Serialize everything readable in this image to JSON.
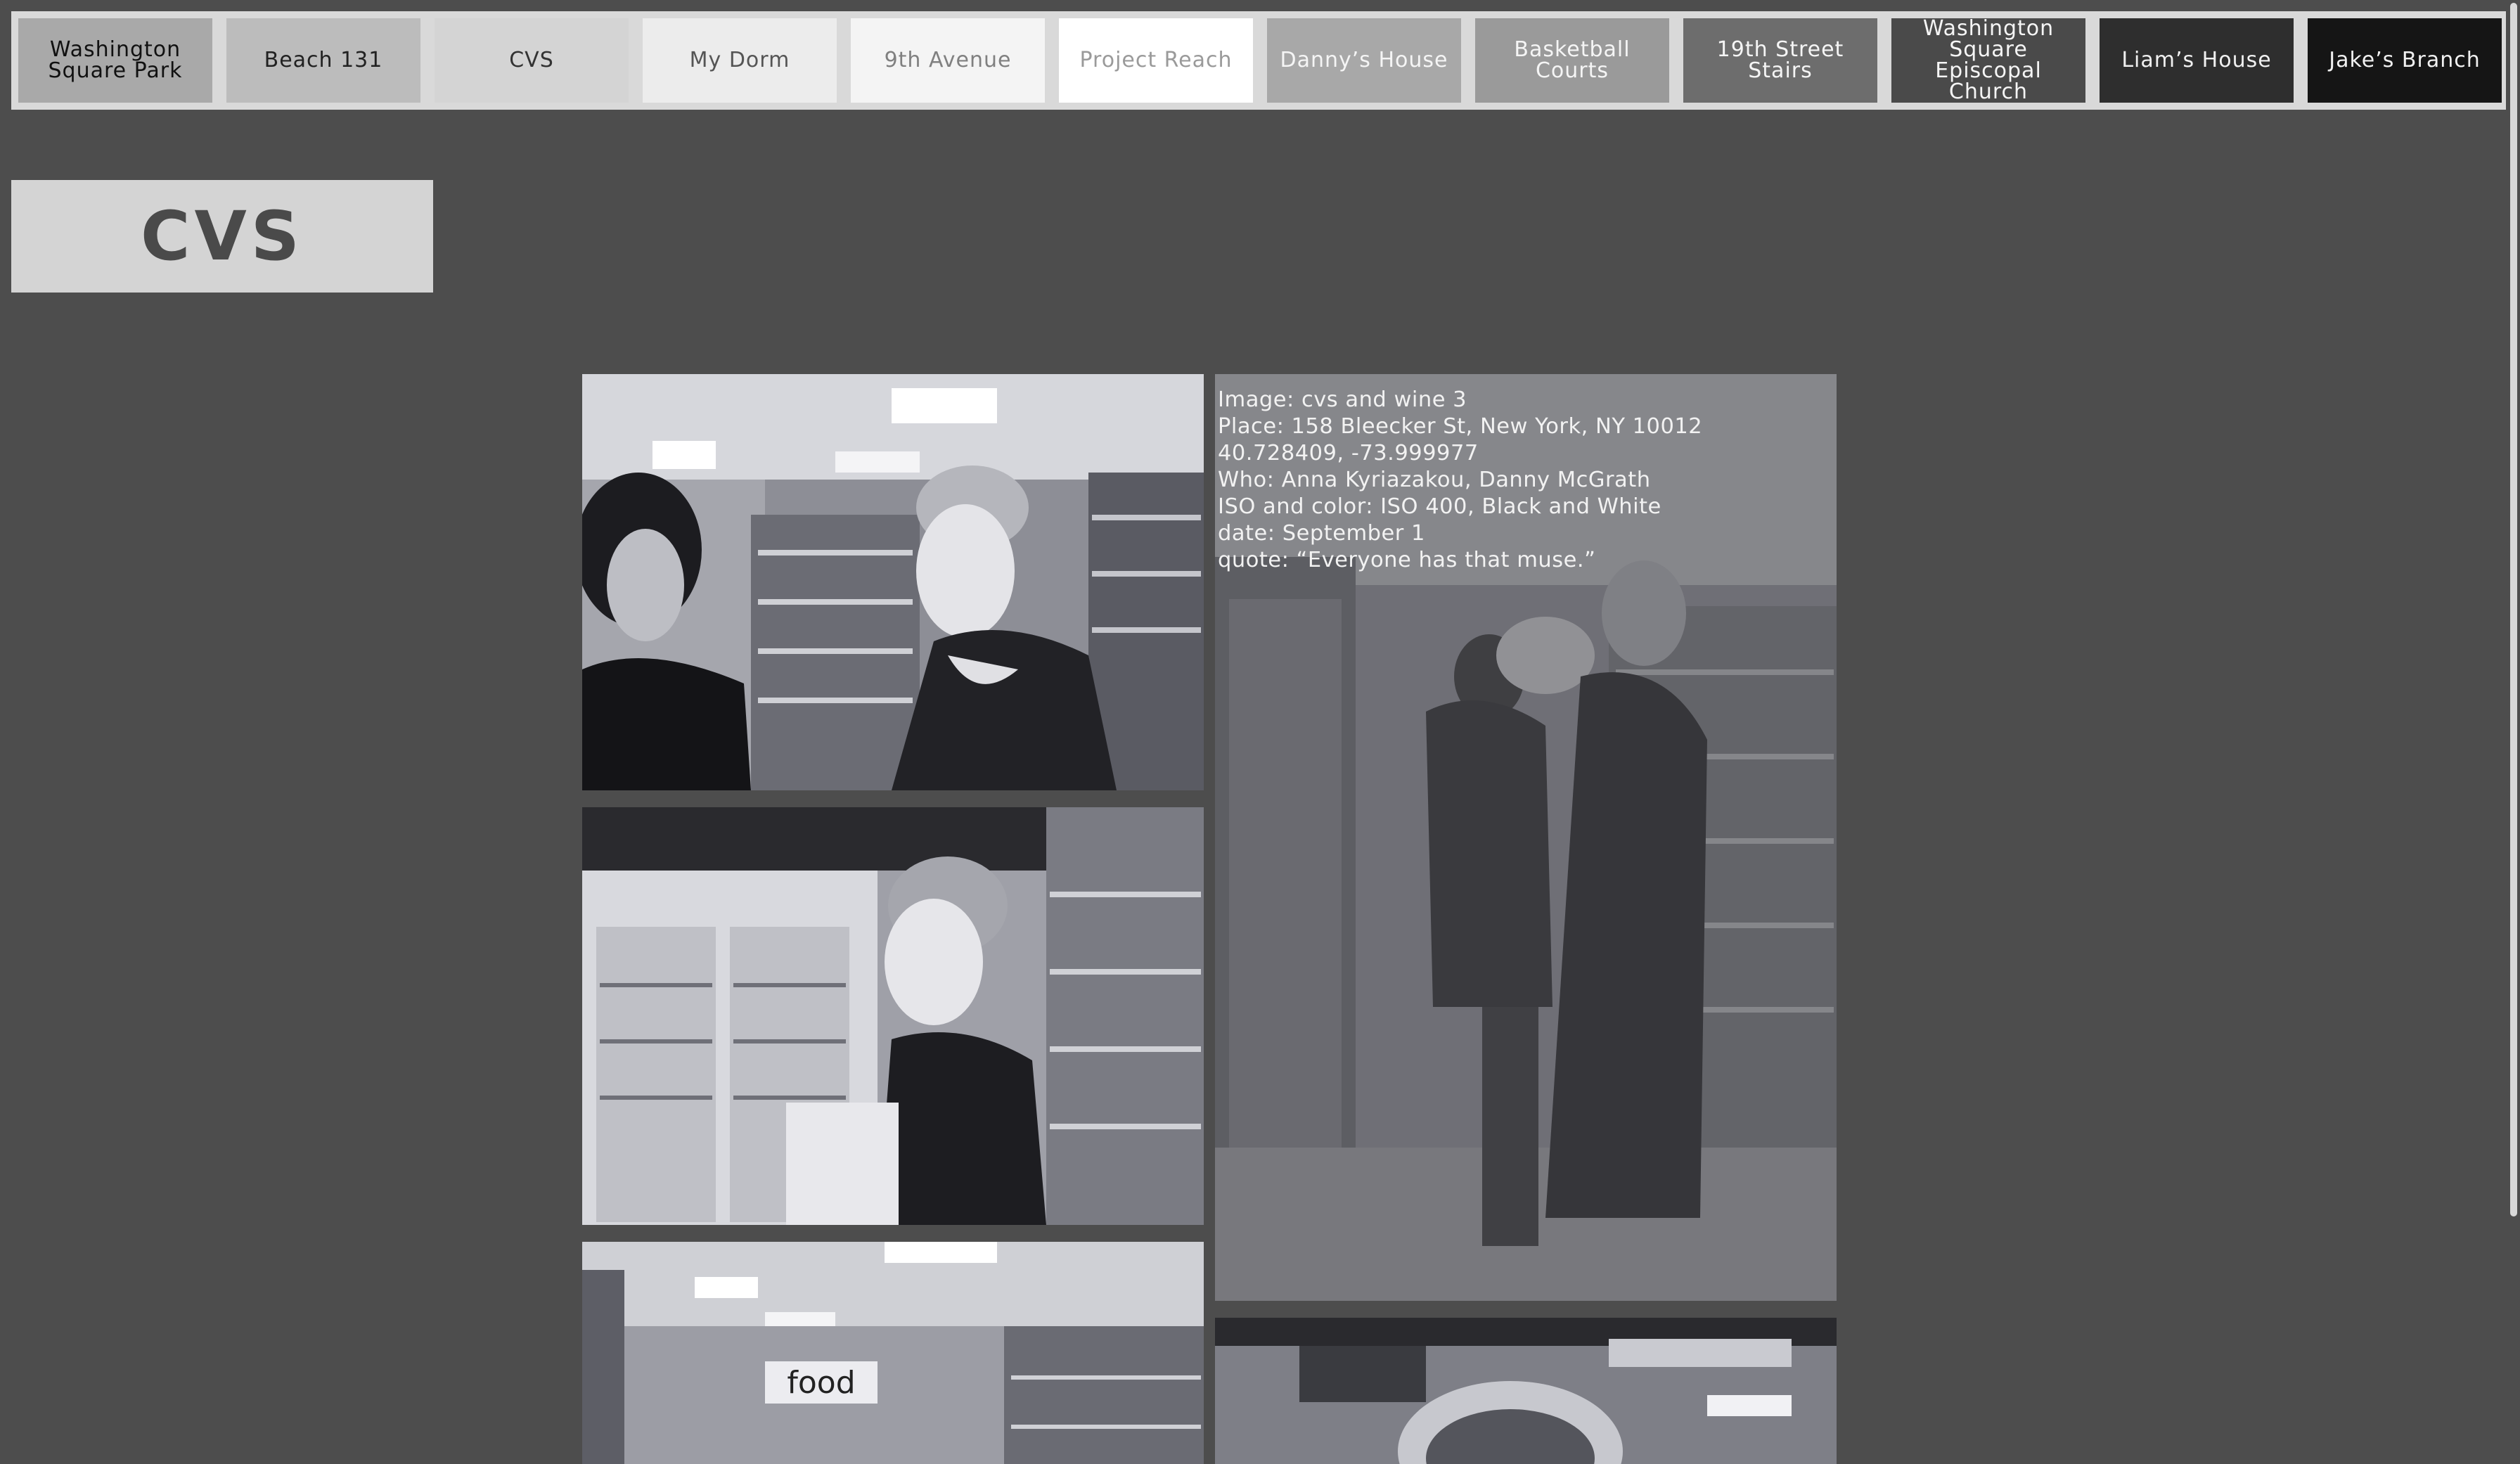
{
  "nav": {
    "tabs": [
      {
        "label": "Washington Square Park",
        "bg": "#a9a9a9",
        "color": "#111111"
      },
      {
        "label": "Beach 131",
        "bg": "#bcbcbc",
        "color": "#222222"
      },
      {
        "label": "CVS",
        "bg": "#d4d4d4",
        "color": "#333333"
      },
      {
        "label": "My Dorm",
        "bg": "#ececec",
        "color": "#555555"
      },
      {
        "label": "9th Avenue",
        "bg": "#f4f4f4",
        "color": "#808080"
      },
      {
        "label": "Project Reach",
        "bg": "#ffffff",
        "color": "#9a9a9a"
      },
      {
        "label": "Danny’s House",
        "bg": "#a8a8a8",
        "color": "#f5f5f5"
      },
      {
        "label": "Basketball Courts",
        "bg": "#9a9a9a",
        "color": "#f5f5f5"
      },
      {
        "label": "19th Street Stairs",
        "bg": "#6d6d6d",
        "color": "#f5f5f5"
      },
      {
        "label": "Washington Square Episcopal Church",
        "bg": "#4a4a4a",
        "color": "#f5f5f5"
      },
      {
        "label": "Liam’s House",
        "bg": "#2e2e2e",
        "color": "#f0f0f0"
      },
      {
        "label": "Jake’s Branch",
        "bg": "#151515",
        "color": "#f0f0f0"
      }
    ]
  },
  "page": {
    "title": "CVS"
  },
  "gallery": {
    "caption": {
      "image": "Image: cvs and wine 3",
      "place": "Place: 158 Bleecker St, New York, NY 10012",
      "coords": "40.728409, -73.999977",
      "who": "Who: Anna Kyriazakou, Danny McGrath",
      "iso": "ISO and color: ISO 400, Black and White",
      "date": "date: September 1",
      "quote": "quote: “Everyone has that muse.”"
    },
    "sign_text": "food"
  },
  "colors": {
    "background": "#4d4d4d",
    "nav_bar": "#d9d9d9",
    "title_box": "#d4d4d4"
  }
}
